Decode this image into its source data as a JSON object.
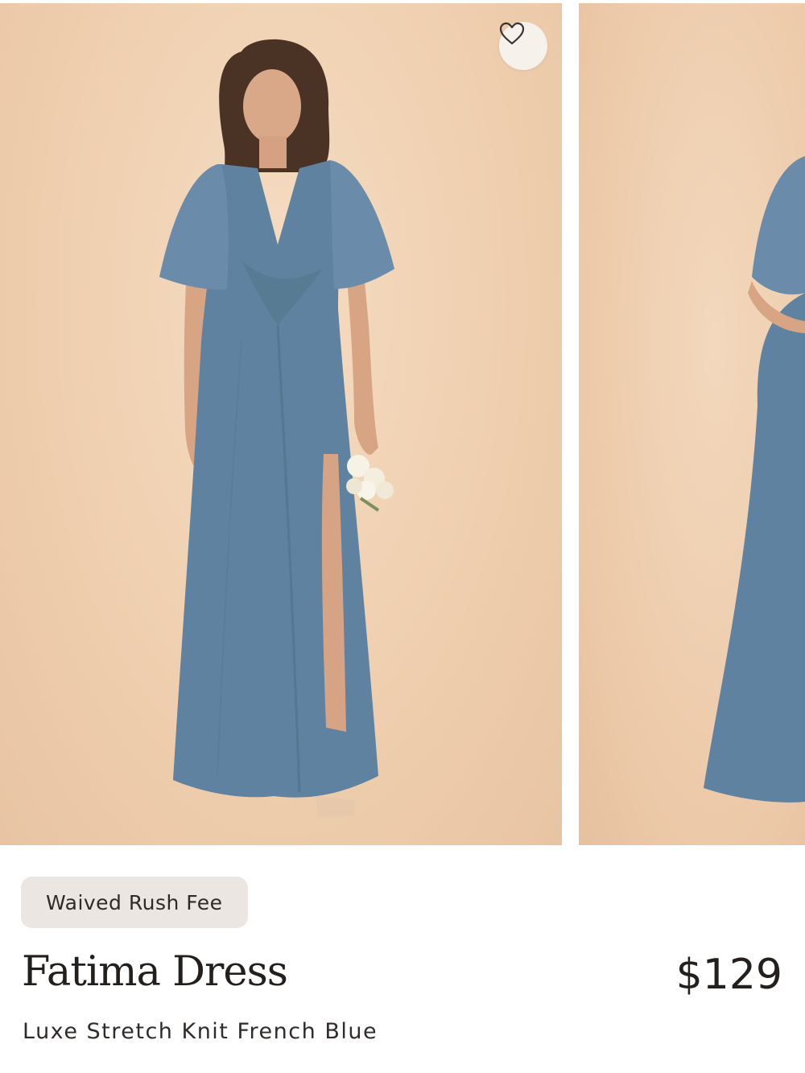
{
  "product": {
    "badge": "Waived Rush Fee",
    "name": "Fatima Dress",
    "price": "$129",
    "subtitle": "Luxe Stretch Knit French Blue"
  },
  "gallery": {
    "images": [
      {
        "subject": "model-front-view",
        "active": true
      },
      {
        "subject": "model-side-view",
        "active": false
      }
    ]
  },
  "icons": {
    "favorite": "heart-outline-icon"
  },
  "colors": {
    "dress": "#5f82a0",
    "background": "#f0d2b4",
    "badge_bg": "#ebe6e2",
    "text": "#231f1d"
  }
}
